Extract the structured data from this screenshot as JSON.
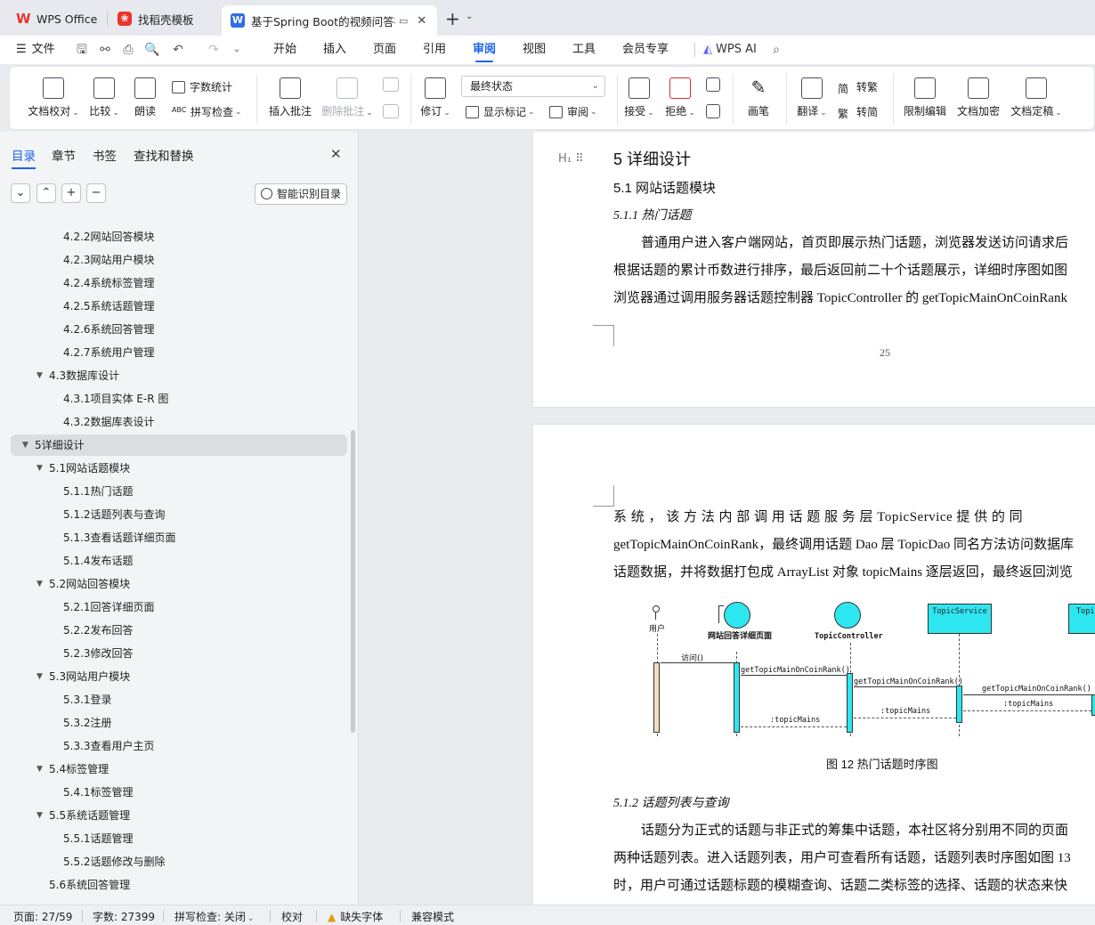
{
  "tabs": [
    {
      "label": "WPS Office",
      "icon": "wps-logo-icon"
    },
    {
      "label": "找稻壳模板",
      "icon": "docer-icon"
    },
    {
      "label": "基于Spring Boot的视频问答社",
      "icon": "word-doc-icon"
    }
  ],
  "menu": {
    "file": "文件",
    "items": [
      "开始",
      "插入",
      "页面",
      "引用",
      "审阅",
      "视图",
      "工具",
      "会员专享"
    ],
    "active": "审阅",
    "ai": "WPS AI"
  },
  "ribbon": {
    "doc_check": "文档校对",
    "compare": "比较",
    "read_aloud": "朗读",
    "word_count": "字数统计",
    "spell_check": "拼写检查",
    "insert_comment": "插入批注",
    "delete_comment": "删除批注",
    "track_changes": "修订",
    "status_value": "最终状态",
    "show_markup": "显示标记",
    "review_pane": "审阅",
    "accept": "接受",
    "reject": "拒绝",
    "pen": "画笔",
    "translate": "翻译",
    "to_traditional": "转繁",
    "to_simplified": "转简",
    "restrict_edit": "限制编辑",
    "encrypt": "文档加密",
    "finalize": "文档定稿"
  },
  "nav": {
    "tabs": [
      "目录",
      "章节",
      "书签",
      "查找和替换"
    ],
    "smart_toc": "智能识别目录",
    "toc": [
      {
        "label": "4.2.2网站回答模块",
        "level": 3,
        "arrow": false
      },
      {
        "label": "4.2.3网站用户模块",
        "level": 3,
        "arrow": false
      },
      {
        "label": "4.2.4系统标签管理",
        "level": 3,
        "arrow": false
      },
      {
        "label": "4.2.5系统话题管理",
        "level": 3,
        "arrow": false
      },
      {
        "label": "4.2.6系统回答管理",
        "level": 3,
        "arrow": false
      },
      {
        "label": "4.2.7系统用户管理",
        "level": 3,
        "arrow": false
      },
      {
        "label": "4.3数据库设计",
        "level": 2,
        "arrow": true
      },
      {
        "label": "4.3.1项目实体 E-R 图",
        "level": 3,
        "arrow": false
      },
      {
        "label": "4.3.2数据库表设计",
        "level": 3,
        "arrow": false
      },
      {
        "label": "5详细设计",
        "level": 1,
        "arrow": true,
        "selected": true
      },
      {
        "label": "5.1网站话题模块",
        "level": 2,
        "arrow": true
      },
      {
        "label": "5.1.1热门话题",
        "level": 3,
        "arrow": false
      },
      {
        "label": "5.1.2话题列表与查询",
        "level": 3,
        "arrow": false
      },
      {
        "label": "5.1.3查看话题详细页面",
        "level": 3,
        "arrow": false
      },
      {
        "label": "5.1.4发布话题",
        "level": 3,
        "arrow": false
      },
      {
        "label": "5.2网站回答模块",
        "level": 2,
        "arrow": true
      },
      {
        "label": "5.2.1回答详细页面",
        "level": 3,
        "arrow": false
      },
      {
        "label": "5.2.2发布回答",
        "level": 3,
        "arrow": false
      },
      {
        "label": "5.2.3修改回答",
        "level": 3,
        "arrow": false
      },
      {
        "label": "5.3网站用户模块",
        "level": 2,
        "arrow": true
      },
      {
        "label": "5.3.1登录",
        "level": 3,
        "arrow": false
      },
      {
        "label": "5.3.2注册",
        "level": 3,
        "arrow": false
      },
      {
        "label": "5.3.3查看用户主页",
        "level": 3,
        "arrow": false
      },
      {
        "label": "5.4标签管理",
        "level": 2,
        "arrow": true
      },
      {
        "label": "5.4.1标签管理",
        "level": 3,
        "arrow": false
      },
      {
        "label": "5.5系统话题管理",
        "level": 2,
        "arrow": true
      },
      {
        "label": "5.5.1话题管理",
        "level": 3,
        "arrow": false
      },
      {
        "label": "5.5.2话题修改与删除",
        "level": 3,
        "arrow": false
      },
      {
        "label": "5.6系统回答管理",
        "level": 2,
        "arrow": false
      }
    ]
  },
  "doc": {
    "h1": "5  详细设计",
    "h2": "5.1  网站话题模块",
    "h3_1": "5.1.1  热门话题",
    "p1_lines": [
      "普通用户进入客户端网站，首页即展示热门话题，浏览器发送访问请求后",
      "根据话题的累计币数进行排序，最后返回前二十个话题展示，详细时序图如图",
      "浏览器通过调用服务器话题控制器 TopicController 的 getTopicMainOnCoinRank"
    ],
    "page_number": "25",
    "p2_lines": [
      "系 统 ， 该 方 法 内 部 调 用 话 题 服 务 层  TopicService  提 供 的 同",
      "getTopicMainOnCoinRank，最终调用话题 Dao 层 TopicDao 同名方法访问数据库",
      "话题数据，并将数据打包成 ArrayList 对象 topicMains 逐层返回，最终返回浏览"
    ],
    "figure_caption": "图 12  热门话题时序图",
    "h3_2": "5.1.2  话题列表与查询",
    "p3_lines": [
      "话题分为正式的话题与非正式的筹集中话题，本社区将分别用不同的页面",
      "两种话题列表。进入话题列表，用户可查看所有话题，话题列表时序图如图 13",
      "时，用户可通过话题标题的模糊查询、话题二类标签的选择、话题的状态来快"
    ]
  },
  "diagram": {
    "actor": "用户",
    "boundary": "网站回答详细页面",
    "control": "TopicController",
    "service": "TopicService",
    "dao": "Topi",
    "msg_visit": "访问()",
    "msg_call1": "getTopicMainOnCoinRank()",
    "msg_call2": "getTopicMainOnCoinRank()",
    "msg_call3": "getTopicMainOnCoinRank()",
    "ret1": ":topicMains",
    "ret2": ":topicMains",
    "ret3": ":topicMains"
  },
  "status": {
    "page": "页面: 27/59",
    "words": "字数: 27399",
    "spell": "拼写检查: 关闭",
    "proof": "校对",
    "missing_font": "缺失字体",
    "compat": "兼容模式"
  },
  "colors": {
    "accent": "#1a64e8",
    "diagram_fill": "#2ee6f0",
    "wps_red": "#e8342c"
  }
}
